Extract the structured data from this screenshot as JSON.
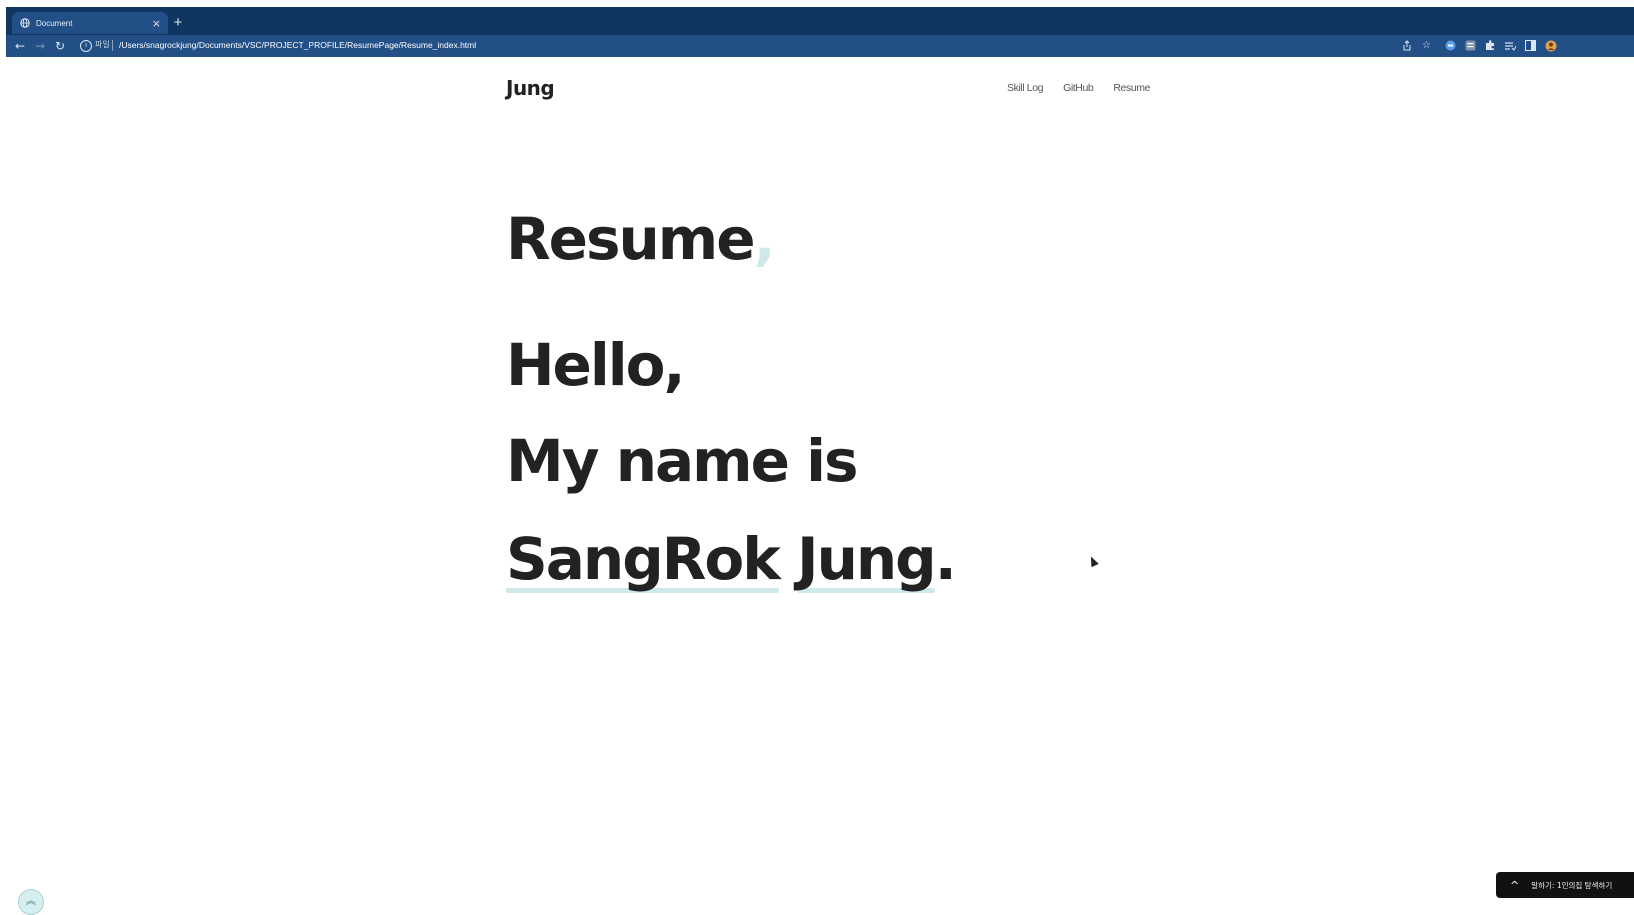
{
  "browser": {
    "tab_title": "Document",
    "tab_close": "×",
    "new_tab": "+",
    "scheme_label": "파일",
    "url": "/Users/snagrockjung/Documents/VSC/PROJECT_PROFILE/ResumePage/Resume_index.html",
    "icons": [
      "back-arrow-icon",
      "forward-arrow-icon",
      "reload-icon",
      "info-icon",
      "share-icon",
      "star-icon",
      "extension-icons",
      "puzzle-icon",
      "reading-list-icon",
      "side-panel-icon",
      "profile-avatar-icon"
    ]
  },
  "site": {
    "logo": "Jung",
    "nav": [
      {
        "label": "Skill Log"
      },
      {
        "label": "GitHub"
      },
      {
        "label": "Resume"
      }
    ]
  },
  "hero": {
    "title": "Resume",
    "title_comma": ",",
    "line1": "Hello,",
    "line2": "My name is",
    "name_first": "SangRok",
    "name_space": " ",
    "name_last": "Jung",
    "name_period": "."
  },
  "toast": {
    "text": "말하기: 1인의집 탐색하기"
  },
  "colors": {
    "chrome_dark": "#0f3561",
    "chrome_toolbar": "#214f86",
    "accent": "#cde9ea",
    "text": "#222222"
  }
}
